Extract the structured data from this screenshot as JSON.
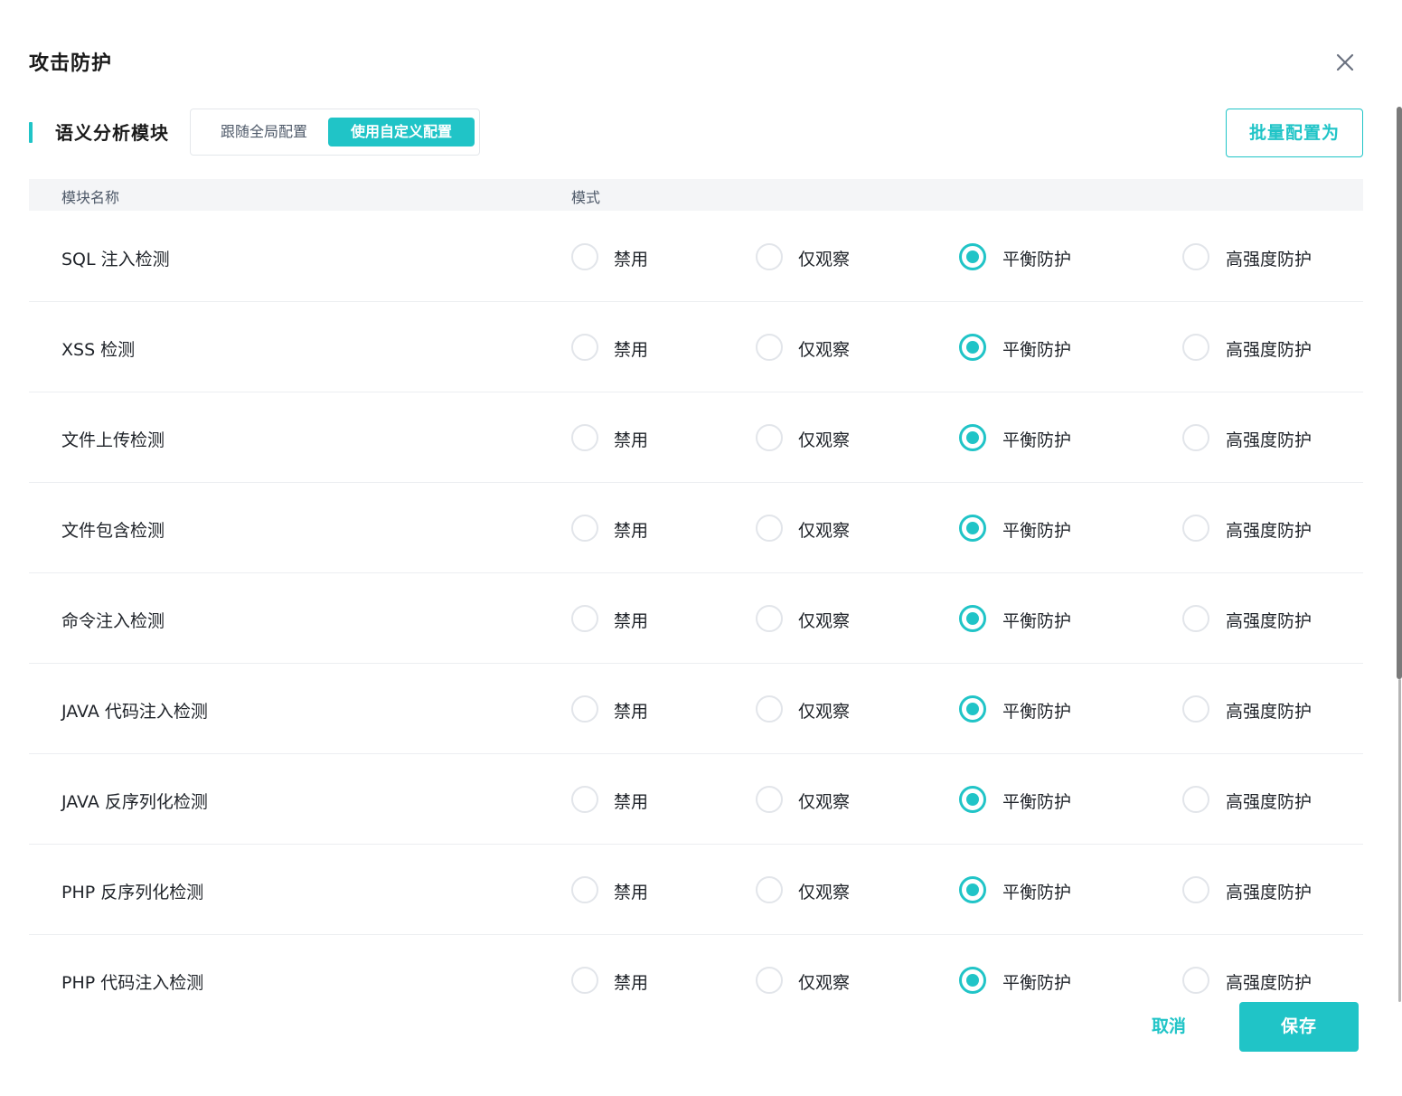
{
  "dialog": {
    "title": "攻击防护",
    "close_icon": "close-icon"
  },
  "section": {
    "title": "语义分析模块",
    "config_modes": [
      "跟随全局配置",
      "使用自定义配置"
    ],
    "selected_config_mode": "使用自定义配置",
    "batch_button_label": "批量配置为"
  },
  "table": {
    "headers": {
      "name": "模块名称",
      "mode": "模式"
    },
    "mode_options": [
      "禁用",
      "仅观察",
      "平衡防护",
      "高强度防护"
    ],
    "rows": [
      {
        "name": "SQL 注入检测",
        "selected": "平衡防护"
      },
      {
        "name": "XSS 检测",
        "selected": "平衡防护"
      },
      {
        "name": "文件上传检测",
        "selected": "平衡防护"
      },
      {
        "name": "文件包含检测",
        "selected": "平衡防护"
      },
      {
        "name": "命令注入检测",
        "selected": "平衡防护"
      },
      {
        "name": "JAVA 代码注入检测",
        "selected": "平衡防护"
      },
      {
        "name": "JAVA 反序列化检测",
        "selected": "平衡防护"
      },
      {
        "name": "PHP 反序列化检测",
        "selected": "平衡防护"
      },
      {
        "name": "PHP 代码注入检测",
        "selected": "平衡防护"
      }
    ]
  },
  "footer": {
    "cancel_label": "取消",
    "save_label": "保存"
  },
  "colors": {
    "accent": "#20c4c7",
    "header_bg": "#f4f5f7",
    "text": "#1f2329",
    "muted_text": "#4e5969"
  }
}
